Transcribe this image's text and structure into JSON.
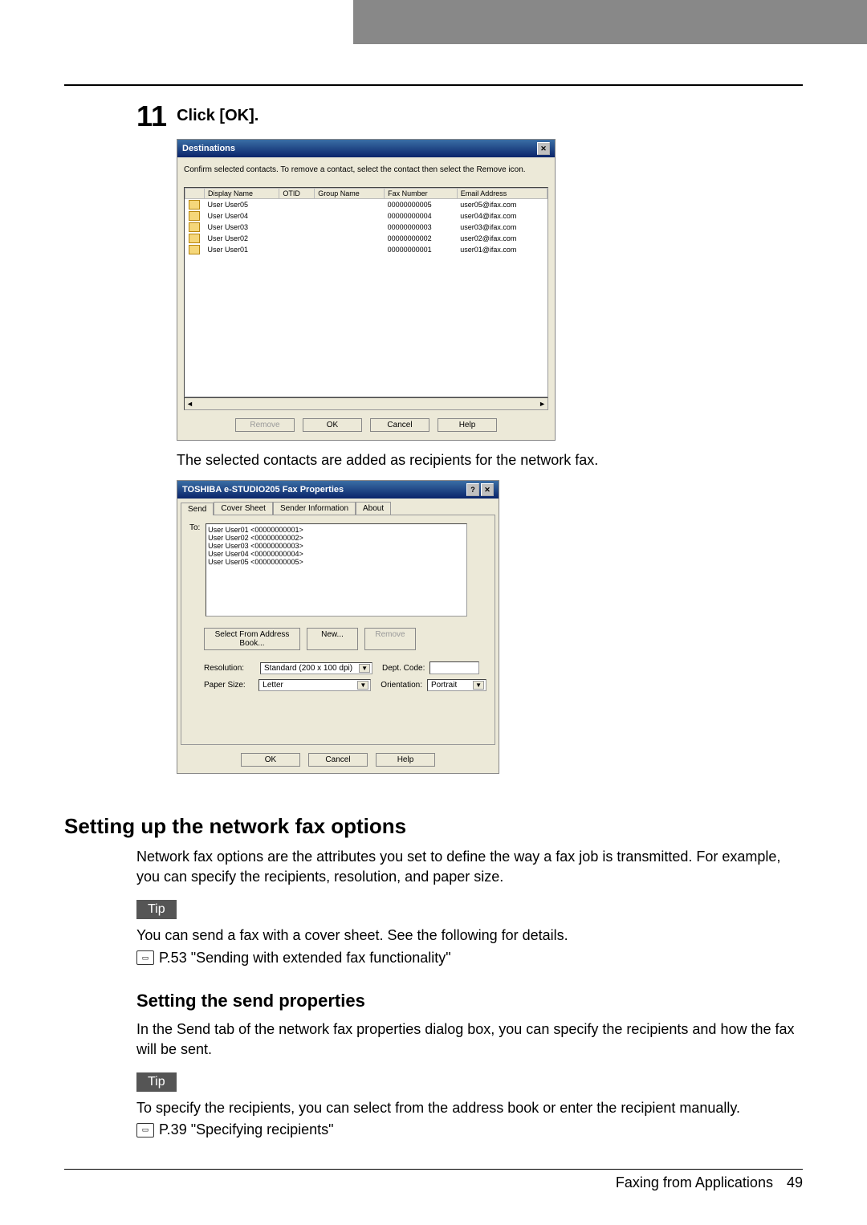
{
  "step": {
    "num": "11",
    "title": "Click [OK]."
  },
  "dialog1": {
    "title": "Destinations",
    "instruction": "Confirm selected contacts. To remove a contact, select the contact then select the Remove icon.",
    "cols": {
      "c1": "Display Name",
      "c2": "OTID",
      "c3": "Group Name",
      "c4": "Fax Number",
      "c5": "Email Address"
    },
    "rows": [
      {
        "name": "User User05",
        "fax": "00000000005",
        "email": "user05@ifax.com"
      },
      {
        "name": "User User04",
        "fax": "00000000004",
        "email": "user04@ifax.com"
      },
      {
        "name": "User User03",
        "fax": "00000000003",
        "email": "user03@ifax.com"
      },
      {
        "name": "User User02",
        "fax": "00000000002",
        "email": "user02@ifax.com"
      },
      {
        "name": "User User01",
        "fax": "00000000001",
        "email": "user01@ifax.com"
      }
    ],
    "buttons": {
      "remove": "Remove",
      "ok": "OK",
      "cancel": "Cancel",
      "help": "Help"
    }
  },
  "caption1": "The selected contacts are added as recipients for the network fax.",
  "dialog2": {
    "title": "TOSHIBA e-STUDIO205 Fax Properties",
    "tabs": {
      "t1": "Send",
      "t2": "Cover Sheet",
      "t3": "Sender Information",
      "t4": "About"
    },
    "to_label": "To:",
    "recipients": "User User01 <00000000001>\nUser User02 <00000000002>\nUser User03 <00000000003>\nUser User04 <00000000004>\nUser User05 <00000000005>",
    "buttons": {
      "addr": "Select From Address Book...",
      "new": "New...",
      "remove": "Remove"
    },
    "fields": {
      "res_lbl": "Resolution:",
      "res_val": "Standard (200 x 100 dpi)",
      "dept_lbl": "Dept. Code:",
      "size_lbl": "Paper Size:",
      "size_val": "Letter",
      "orient_lbl": "Orientation:",
      "orient_val": "Portrait"
    },
    "bottom": {
      "ok": "OK",
      "cancel": "Cancel",
      "help": "Help"
    }
  },
  "section1": {
    "heading": "Setting up the network fax options",
    "body": "Network fax options are the attributes you set to define the way a fax job is transmitted. For example, you can specify the recipients, resolution, and paper size.",
    "tip": "Tip",
    "tipbody": "You can send a fax with a cover sheet. See the following for details.",
    "ref": "P.53 \"Sending with extended fax functionality\""
  },
  "section2": {
    "heading": "Setting the send properties",
    "body": "In the Send tab of the network fax properties dialog box, you can specify the recipients and how the fax will be sent.",
    "tip": "Tip",
    "tipbody": "To specify the recipients, you can select from the address book or enter the recipient manually.",
    "ref": "P.39 \"Specifying recipients\""
  },
  "footer": {
    "text": "Faxing from Applications",
    "page": "49"
  }
}
